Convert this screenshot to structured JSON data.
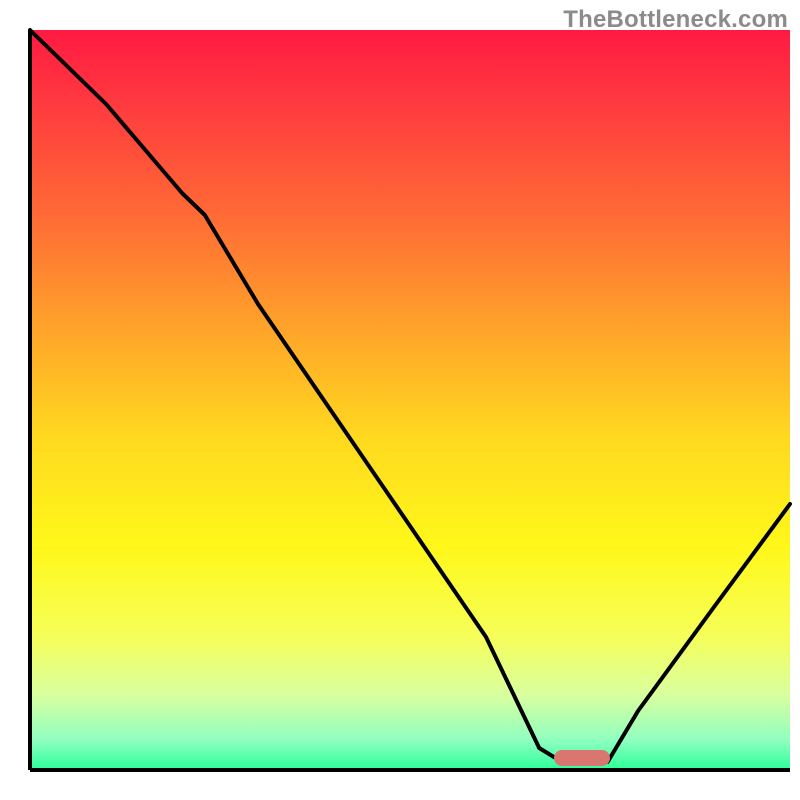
{
  "watermark": "TheBottleneck.com",
  "chart_data": {
    "type": "line",
    "title": "",
    "xlabel": "",
    "ylabel": "",
    "xlim": [
      0,
      100
    ],
    "ylim": [
      0,
      100
    ],
    "grid": false,
    "axes_visible": false,
    "background_gradient": {
      "stops": [
        {
          "offset": 0.0,
          "color": "#ff1a42"
        },
        {
          "offset": 0.1,
          "color": "#ff3a3f"
        },
        {
          "offset": 0.25,
          "color": "#ff6a35"
        },
        {
          "offset": 0.4,
          "color": "#ffa22a"
        },
        {
          "offset": 0.55,
          "color": "#ffd91f"
        },
        {
          "offset": 0.7,
          "color": "#fff81a"
        },
        {
          "offset": 0.82,
          "color": "#f6ff5a"
        },
        {
          "offset": 0.9,
          "color": "#d8ffa0"
        },
        {
          "offset": 0.96,
          "color": "#8fffc0"
        },
        {
          "offset": 1.0,
          "color": "#2aff9a"
        }
      ]
    },
    "marker": {
      "x": 72,
      "y": 2.5,
      "width_pct": 6,
      "color": "#d9766f"
    },
    "curve": {
      "description": "Bottleneck penalty curve: starts at 100 at x=0, drops steeply with a knee near x≈23,y≈75, then descends roughly linearly until flattening to ~0 around x≈68–76 (the marker zone), then rises again toward x=100.",
      "x": [
        0,
        10,
        20,
        23,
        30,
        40,
        50,
        60,
        67,
        70,
        76,
        80,
        90,
        100
      ],
      "y": [
        100,
        90,
        78,
        75,
        63,
        48,
        33,
        18,
        3,
        1,
        1,
        8,
        22,
        36
      ]
    }
  }
}
